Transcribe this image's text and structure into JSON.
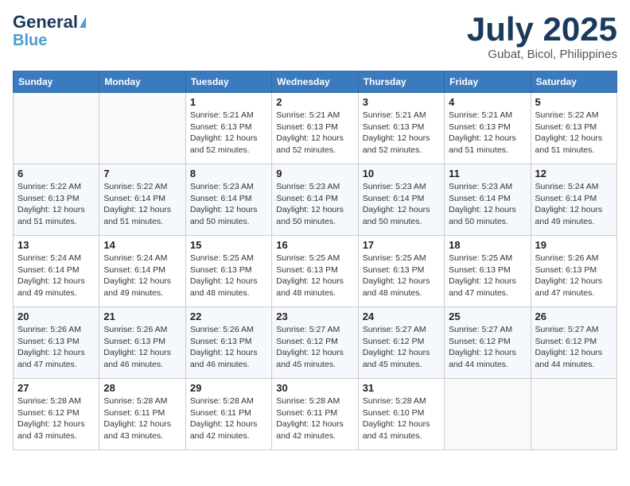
{
  "header": {
    "logo_line1": "General",
    "logo_line2": "Blue",
    "month": "July 2025",
    "location": "Gubat, Bicol, Philippines"
  },
  "weekdays": [
    "Sunday",
    "Monday",
    "Tuesday",
    "Wednesday",
    "Thursday",
    "Friday",
    "Saturday"
  ],
  "weeks": [
    [
      {
        "day": "",
        "info": ""
      },
      {
        "day": "",
        "info": ""
      },
      {
        "day": "1",
        "info": "Sunrise: 5:21 AM\nSunset: 6:13 PM\nDaylight: 12 hours and 52 minutes."
      },
      {
        "day": "2",
        "info": "Sunrise: 5:21 AM\nSunset: 6:13 PM\nDaylight: 12 hours and 52 minutes."
      },
      {
        "day": "3",
        "info": "Sunrise: 5:21 AM\nSunset: 6:13 PM\nDaylight: 12 hours and 52 minutes."
      },
      {
        "day": "4",
        "info": "Sunrise: 5:21 AM\nSunset: 6:13 PM\nDaylight: 12 hours and 51 minutes."
      },
      {
        "day": "5",
        "info": "Sunrise: 5:22 AM\nSunset: 6:13 PM\nDaylight: 12 hours and 51 minutes."
      }
    ],
    [
      {
        "day": "6",
        "info": "Sunrise: 5:22 AM\nSunset: 6:13 PM\nDaylight: 12 hours and 51 minutes."
      },
      {
        "day": "7",
        "info": "Sunrise: 5:22 AM\nSunset: 6:14 PM\nDaylight: 12 hours and 51 minutes."
      },
      {
        "day": "8",
        "info": "Sunrise: 5:23 AM\nSunset: 6:14 PM\nDaylight: 12 hours and 50 minutes."
      },
      {
        "day": "9",
        "info": "Sunrise: 5:23 AM\nSunset: 6:14 PM\nDaylight: 12 hours and 50 minutes."
      },
      {
        "day": "10",
        "info": "Sunrise: 5:23 AM\nSunset: 6:14 PM\nDaylight: 12 hours and 50 minutes."
      },
      {
        "day": "11",
        "info": "Sunrise: 5:23 AM\nSunset: 6:14 PM\nDaylight: 12 hours and 50 minutes."
      },
      {
        "day": "12",
        "info": "Sunrise: 5:24 AM\nSunset: 6:14 PM\nDaylight: 12 hours and 49 minutes."
      }
    ],
    [
      {
        "day": "13",
        "info": "Sunrise: 5:24 AM\nSunset: 6:14 PM\nDaylight: 12 hours and 49 minutes."
      },
      {
        "day": "14",
        "info": "Sunrise: 5:24 AM\nSunset: 6:14 PM\nDaylight: 12 hours and 49 minutes."
      },
      {
        "day": "15",
        "info": "Sunrise: 5:25 AM\nSunset: 6:13 PM\nDaylight: 12 hours and 48 minutes."
      },
      {
        "day": "16",
        "info": "Sunrise: 5:25 AM\nSunset: 6:13 PM\nDaylight: 12 hours and 48 minutes."
      },
      {
        "day": "17",
        "info": "Sunrise: 5:25 AM\nSunset: 6:13 PM\nDaylight: 12 hours and 48 minutes."
      },
      {
        "day": "18",
        "info": "Sunrise: 5:25 AM\nSunset: 6:13 PM\nDaylight: 12 hours and 47 minutes."
      },
      {
        "day": "19",
        "info": "Sunrise: 5:26 AM\nSunset: 6:13 PM\nDaylight: 12 hours and 47 minutes."
      }
    ],
    [
      {
        "day": "20",
        "info": "Sunrise: 5:26 AM\nSunset: 6:13 PM\nDaylight: 12 hours and 47 minutes."
      },
      {
        "day": "21",
        "info": "Sunrise: 5:26 AM\nSunset: 6:13 PM\nDaylight: 12 hours and 46 minutes."
      },
      {
        "day": "22",
        "info": "Sunrise: 5:26 AM\nSunset: 6:13 PM\nDaylight: 12 hours and 46 minutes."
      },
      {
        "day": "23",
        "info": "Sunrise: 5:27 AM\nSunset: 6:12 PM\nDaylight: 12 hours and 45 minutes."
      },
      {
        "day": "24",
        "info": "Sunrise: 5:27 AM\nSunset: 6:12 PM\nDaylight: 12 hours and 45 minutes."
      },
      {
        "day": "25",
        "info": "Sunrise: 5:27 AM\nSunset: 6:12 PM\nDaylight: 12 hours and 44 minutes."
      },
      {
        "day": "26",
        "info": "Sunrise: 5:27 AM\nSunset: 6:12 PM\nDaylight: 12 hours and 44 minutes."
      }
    ],
    [
      {
        "day": "27",
        "info": "Sunrise: 5:28 AM\nSunset: 6:12 PM\nDaylight: 12 hours and 43 minutes."
      },
      {
        "day": "28",
        "info": "Sunrise: 5:28 AM\nSunset: 6:11 PM\nDaylight: 12 hours and 43 minutes."
      },
      {
        "day": "29",
        "info": "Sunrise: 5:28 AM\nSunset: 6:11 PM\nDaylight: 12 hours and 42 minutes."
      },
      {
        "day": "30",
        "info": "Sunrise: 5:28 AM\nSunset: 6:11 PM\nDaylight: 12 hours and 42 minutes."
      },
      {
        "day": "31",
        "info": "Sunrise: 5:28 AM\nSunset: 6:10 PM\nDaylight: 12 hours and 41 minutes."
      },
      {
        "day": "",
        "info": ""
      },
      {
        "day": "",
        "info": ""
      }
    ]
  ]
}
